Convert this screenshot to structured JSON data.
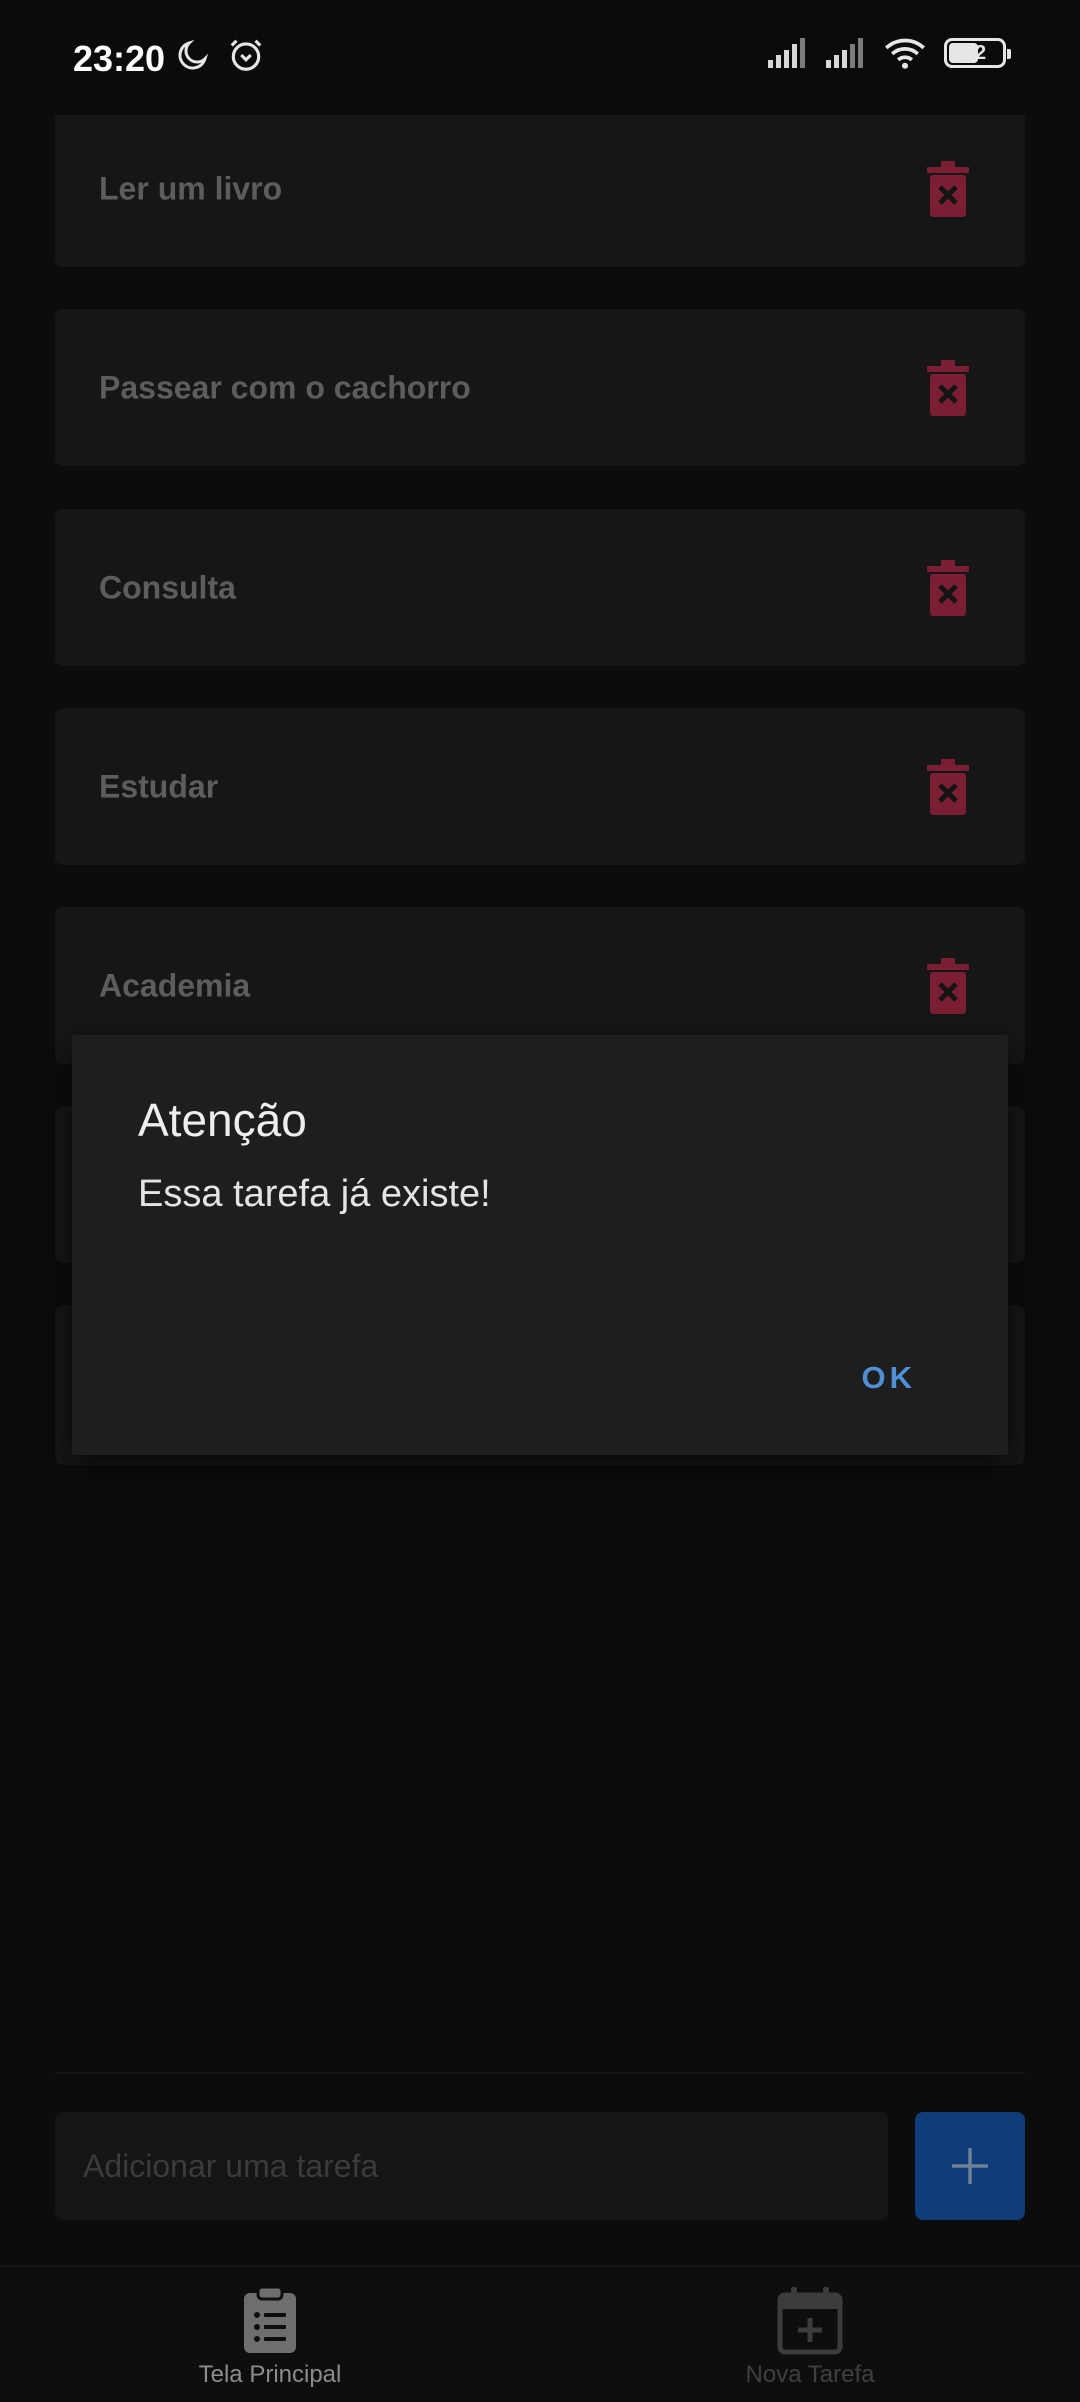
{
  "status_bar": {
    "time": "23:20",
    "battery": "52",
    "icons_left": [
      "moon-icon",
      "alarm-icon"
    ],
    "icons_right": [
      "signal-icon",
      "signal-icon",
      "wifi-icon",
      "battery-icon"
    ]
  },
  "tasks": [
    {
      "label": "Ler um livro"
    },
    {
      "label": "Passear com o cachorro"
    },
    {
      "label": "Consulta"
    },
    {
      "label": "Estudar"
    },
    {
      "label": "Academia"
    }
  ],
  "dialog": {
    "title": "Atenção",
    "message": "Essa tarefa já existe!",
    "ok_label": "OK"
  },
  "input": {
    "placeholder": "Adicionar uma tarefa",
    "value": ""
  },
  "nav": {
    "main_label": "Tela Principal",
    "new_label": "Nova Tarefa"
  },
  "colors": {
    "accent": "#4f8fd6",
    "delete": "#7a1f33",
    "add_button": "#0e3d7a"
  }
}
